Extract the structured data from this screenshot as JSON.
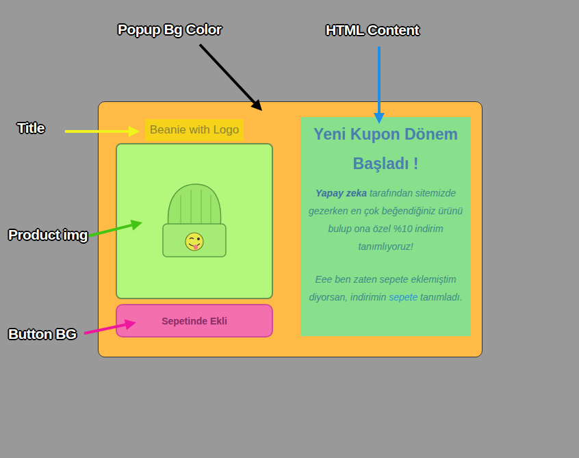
{
  "annotations": [
    {
      "label": "Popup Bg Color",
      "color": "#000000"
    },
    {
      "label": "HTML Content",
      "color": "#1e8fe6"
    },
    {
      "label": "Title",
      "color": "#f2f21c"
    },
    {
      "label": "Product img",
      "color": "#44c414"
    },
    {
      "label": "Button BG",
      "color": "#ee189e"
    }
  ],
  "popup": {
    "product_title": "Beanie with Logo",
    "button": "Sepetinde Ekli",
    "html_content": {
      "heading": "Yeni Kupon Dönem Başladı !",
      "paragraphs": [
        [
          {
            "text": "Yapay zeka",
            "kind": "strong"
          },
          {
            "text": " tarafından sitemizde gezerken en çok beğendiğiniz ürünü bulup ona özel %10 indirim tanımlıyoruz!",
            "kind": "plain"
          }
        ],
        [
          {
            "text": "Eee ben zaten sepete eklemiştim diyorsan, indirimin ",
            "kind": "plain"
          },
          {
            "text": "sepete",
            "kind": "link"
          },
          {
            "text": " tanımladı.",
            "kind": "plain"
          }
        ]
      ]
    }
  }
}
